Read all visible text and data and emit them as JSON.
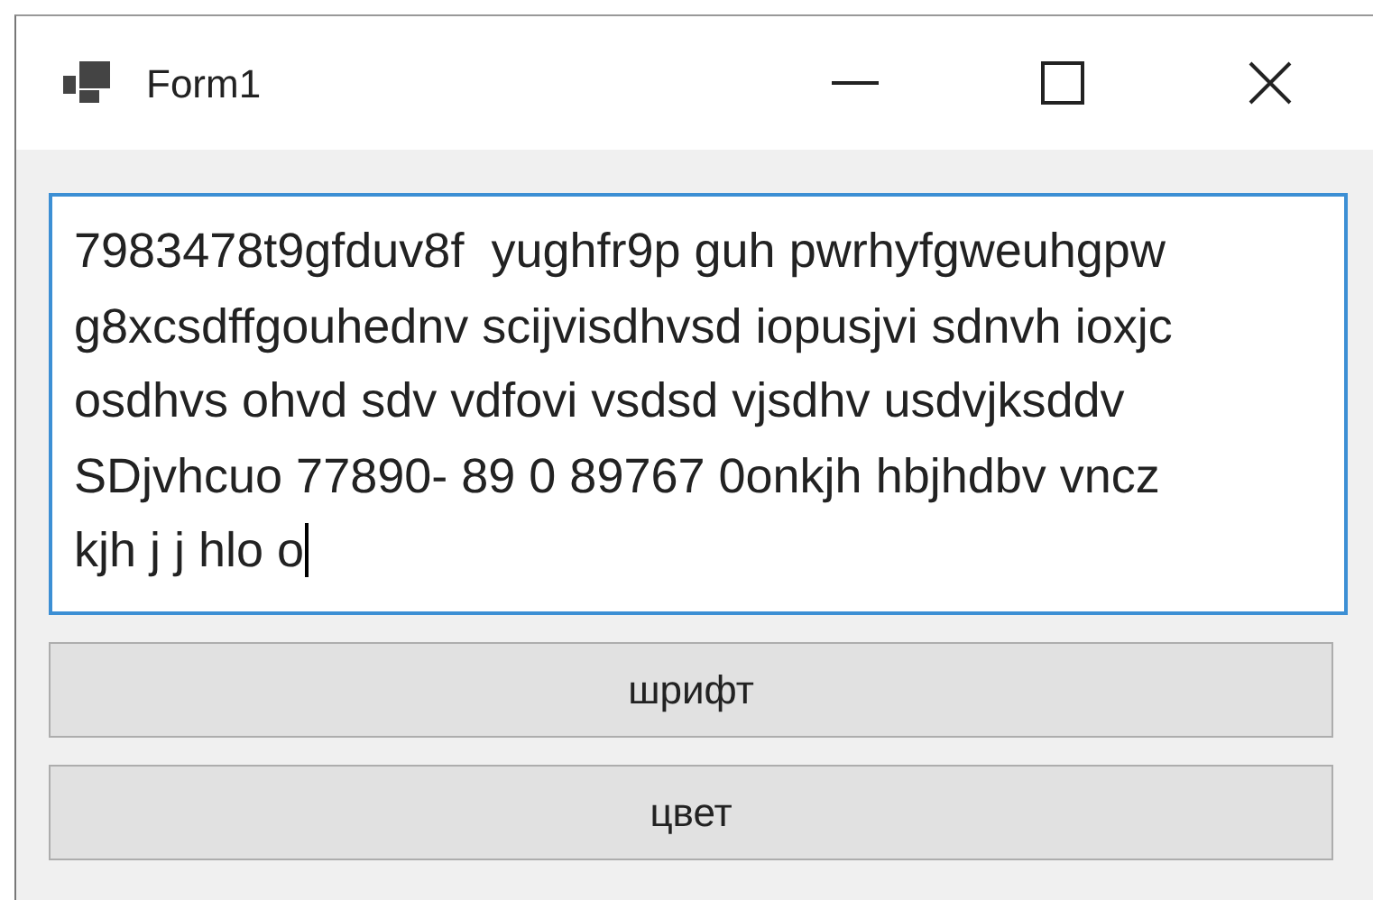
{
  "window": {
    "title": "Form1"
  },
  "text_box": {
    "lines": [
      "7983478t9gfduv8f  yughfr9p guh pwrhyfgweuhgpw",
      "g8xcsdffgouhednv scijvisdhvsd iopusjvi sdnvh ioxjc",
      "osdhvs ohvd sdv vdfovi vsdsd vjsdhv usdvjksddv",
      "SDjvhcuo 77890- 89 0 89767 0onkjh hbjhdbv vncz",
      "kjh j j hlo o"
    ],
    "focused": true
  },
  "buttons": [
    "шрифт",
    "цвет"
  ]
}
